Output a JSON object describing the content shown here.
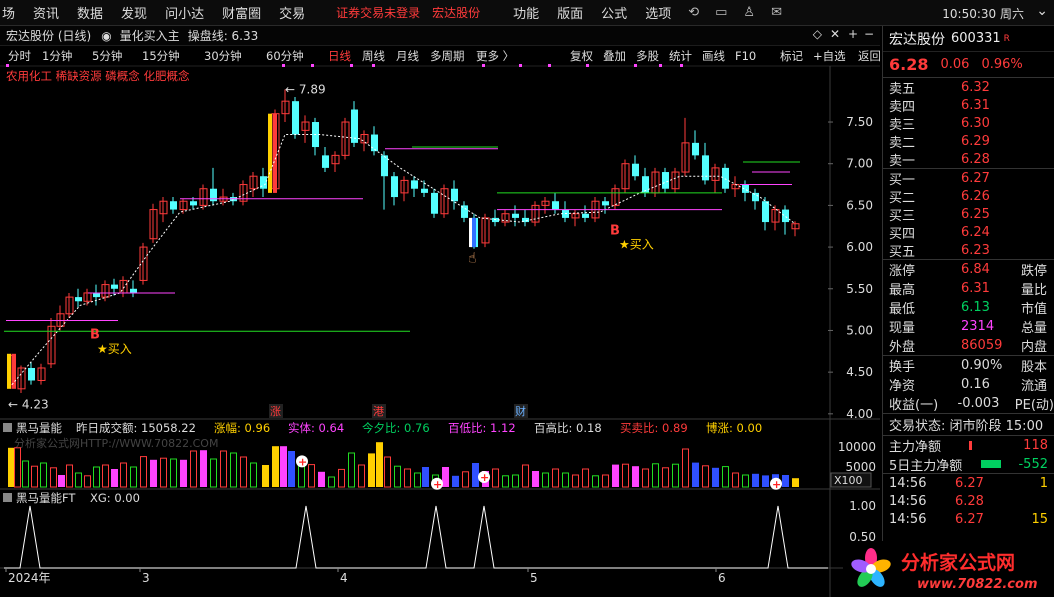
{
  "menu": {
    "items": [
      "场",
      "资讯",
      "数据",
      "发现",
      "问小达",
      "财富圈",
      "交易"
    ],
    "warn": [
      "证券交易未登录",
      "宏达股份"
    ],
    "right_items": [
      "功能",
      "版面",
      "公式",
      "选项"
    ],
    "clock": "10:50:30 周六"
  },
  "chart": {
    "title": "宏达股份 (日线)",
    "indicator_name": "量化买入主",
    "indicator_line": "操盘线: 6.33",
    "periods": [
      "分时",
      "1分钟",
      "5分钟",
      "15分钟",
      "30分钟",
      "60分钟",
      "日线",
      "周线",
      "月线",
      "多周期",
      "更多 〉"
    ],
    "active_period": "日线",
    "tools": [
      "复权",
      "叠加",
      "多股",
      "统计",
      "画线",
      "F10",
      "标记",
      "+自选",
      "返回"
    ],
    "concepts": "农用化工 稀缺资源 磷概念 化肥概念",
    "high_label": "7.89",
    "low_label": "4.23",
    "buy_label": "★买入",
    "buy_marker": "B",
    "events": [
      "涨",
      "港",
      "财"
    ],
    "date_labels": [
      "2024年",
      "3",
      "4",
      "5",
      "6"
    ]
  },
  "price_axis": [
    "7.50",
    "7.00",
    "6.50",
    "6.00",
    "5.50",
    "5.00",
    "4.50",
    "4.00"
  ],
  "vol_header": {
    "name": "黑马量能",
    "items": [
      {
        "k": "昨日成交额:",
        "v": "15058.22",
        "c": "#dddddd"
      },
      {
        "k": "涨幅:",
        "v": "0.96",
        "c": "#ffd000"
      },
      {
        "k": "实体:",
        "v": "0.64",
        "c": "#ff44ff"
      },
      {
        "k": "今夕比:",
        "v": "0.76",
        "c": "#00d060"
      },
      {
        "k": "百低比:",
        "v": "1.12",
        "c": "#ff44ff"
      },
      {
        "k": "百高比:",
        "v": "0.18",
        "c": "#dddddd"
      },
      {
        "k": "买卖比:",
        "v": "0.89",
        "c": "#ff3b3b"
      },
      {
        "k": "博涨:",
        "v": "0.00",
        "c": "#ffd000"
      }
    ],
    "watermark": "分析家公式网HTTP://WWW.70822.COM"
  },
  "vol_axis": [
    "10000",
    "5000",
    "X100"
  ],
  "ft_header": {
    "name": "黑马量能FT",
    "xg": "XG: 0.00"
  },
  "ft_axis": [
    "1.00",
    "0.50"
  ],
  "right_panel": {
    "name": "宏达股份",
    "code": "600331",
    "r": "R",
    "price": "6.28",
    "change": "0.06",
    "pct": "0.96%",
    "sell": [
      {
        "l": "卖五",
        "p": "6.32"
      },
      {
        "l": "卖四",
        "p": "6.31"
      },
      {
        "l": "卖三",
        "p": "6.30"
      },
      {
        "l": "卖二",
        "p": "6.29"
      },
      {
        "l": "卖一",
        "p": "6.28"
      }
    ],
    "buy": [
      {
        "l": "买一",
        "p": "6.27"
      },
      {
        "l": "买二",
        "p": "6.26"
      },
      {
        "l": "买三",
        "p": "6.25"
      },
      {
        "l": "买四",
        "p": "6.24"
      },
      {
        "l": "买五",
        "p": "6.23"
      }
    ],
    "stats": [
      {
        "l": "涨停",
        "v": "6.84",
        "c": "#ff3b3b",
        "l2": "跌停"
      },
      {
        "l": "最高",
        "v": "6.31",
        "c": "#ff3b3b",
        "l2": "量比"
      },
      {
        "l": "最低",
        "v": "6.13",
        "c": "#00d060",
        "l2": "市值"
      },
      {
        "l": "现量",
        "v": "2314",
        "c": "#ff44ff",
        "l2": "总量"
      },
      {
        "l": "外盘",
        "v": "86059",
        "c": "#ff3b3b",
        "l2": "内盘"
      }
    ],
    "stats2": [
      {
        "l": "换手",
        "v": "0.90%",
        "l2": "股本"
      },
      {
        "l": "净资",
        "v": "0.16",
        "l2": "流通"
      },
      {
        "l": "收益(一)",
        "v": "-0.003",
        "l2": "PE(动)"
      }
    ],
    "trade_status": "交易状态: 闭市阶段 15:00",
    "main_net": "主力净额",
    "main_net_v": "118",
    "main_net5": "5日主力净额",
    "main_net5_v": "-552",
    "ticks": [
      {
        "t": "14:56",
        "p": "6.27",
        "v": "1"
      },
      {
        "t": "14:56",
        "p": "6.28",
        "v": ""
      },
      {
        "t": "14:56",
        "p": "6.27",
        "v": "15"
      }
    ],
    "logo_text": "分析家公式网",
    "logo_url": "www.70822.com"
  }
}
